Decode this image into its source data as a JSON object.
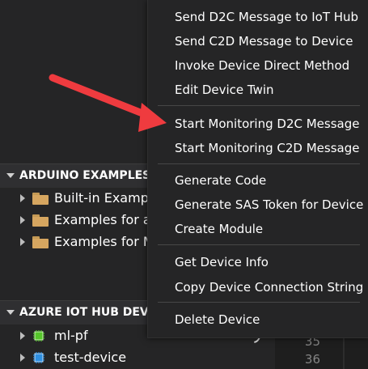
{
  "explorer": {
    "arduino_examples": {
      "title": "ARDUINO EXAMPLES",
      "items": [
        {
          "label": "Built-in Examples",
          "icon": "folder-icon"
        },
        {
          "label": "Examples for any",
          "icon": "folder-icon"
        },
        {
          "label": "Examples for MX",
          "icon": "folder-icon"
        }
      ]
    },
    "azure_iot_hub_devices": {
      "title": "AZURE IOT HUB DEVICES",
      "items": [
        {
          "label": "ml-pf",
          "icon": "chip-icon",
          "status_color": "#55c72a"
        },
        {
          "label": "test-device",
          "icon": "chip-icon",
          "status_color": "#2f8fe0"
        }
      ]
    }
  },
  "editor": {
    "line_numbers": [
      "35",
      "36"
    ]
  },
  "context_menu": {
    "groups": [
      [
        "Send D2C Message to IoT Hub",
        "Send C2D Message to Device",
        "Invoke Device Direct Method",
        "Edit Device Twin"
      ],
      [
        "Start Monitoring D2C Message",
        "Start Monitoring C2D Message"
      ],
      [
        "Generate Code",
        "Generate SAS Token for Device",
        "Create Module"
      ],
      [
        "Get Device Info",
        "Copy Device Connection String"
      ],
      [
        "Delete Device"
      ]
    ]
  },
  "annotation": {
    "arrow_color": "#ef3b3f",
    "target_item": "Start Monitoring D2C Message"
  }
}
